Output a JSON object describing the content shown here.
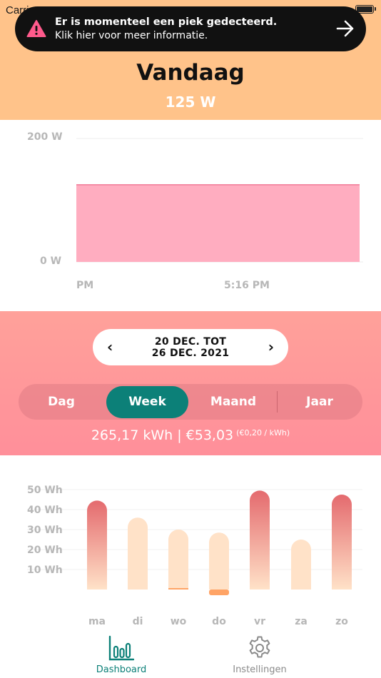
{
  "status_bar": {
    "carrier": "Carrier"
  },
  "alert": {
    "title": "Er is momenteel een piek gedecteerd.",
    "subtitle": "Klik hier voor meer informatie.",
    "icon": "warning-triangle-icon",
    "action_icon": "arrow-right-icon"
  },
  "header": {
    "title": "Vandaag",
    "power": "125 W"
  },
  "today_chart": {
    "type": "area",
    "y_ticks": [
      "200 W",
      "0 W"
    ],
    "x_ticks": [
      "PM",
      "5:16 PM"
    ],
    "ylim": [
      0,
      200
    ],
    "series": [
      {
        "values": [
          125,
          125
        ]
      }
    ],
    "color": "#ffadc0"
  },
  "range": {
    "line1": "20 DEC. TOT",
    "line2": "26 DEC. 2021",
    "prev": "‹",
    "next": "›"
  },
  "segments": [
    {
      "label": "Dag",
      "active": false
    },
    {
      "label": "Week",
      "active": true
    },
    {
      "label": "Maand",
      "active": false
    },
    {
      "label": "Jaar",
      "active": false
    }
  ],
  "summary": {
    "main": "265,17 kWh | €53,03",
    "rate": "(€0,20 / kWh)"
  },
  "chart_data": {
    "type": "bar",
    "categories": [
      "ma",
      "di",
      "wo",
      "do",
      "vr",
      "za",
      "zo"
    ],
    "values": [
      44.5,
      36,
      30,
      28.5,
      49.5,
      25,
      47.5
    ],
    "y_ticks": [
      "50 Wh",
      "40 Wh",
      "30 Wh",
      "20 Wh",
      "10 Wh"
    ],
    "ylim": [
      0,
      50
    ],
    "grid": true,
    "bar_color": "#ffe2c8",
    "peak_color": "#e46a6e",
    "selected_category": "do",
    "selected_color": "#ffa466"
  },
  "tabs": [
    {
      "label": "Dashboard",
      "icon": "bar-chart-icon",
      "active": true
    },
    {
      "label": "Instellingen",
      "icon": "gear-icon",
      "active": false
    }
  ]
}
